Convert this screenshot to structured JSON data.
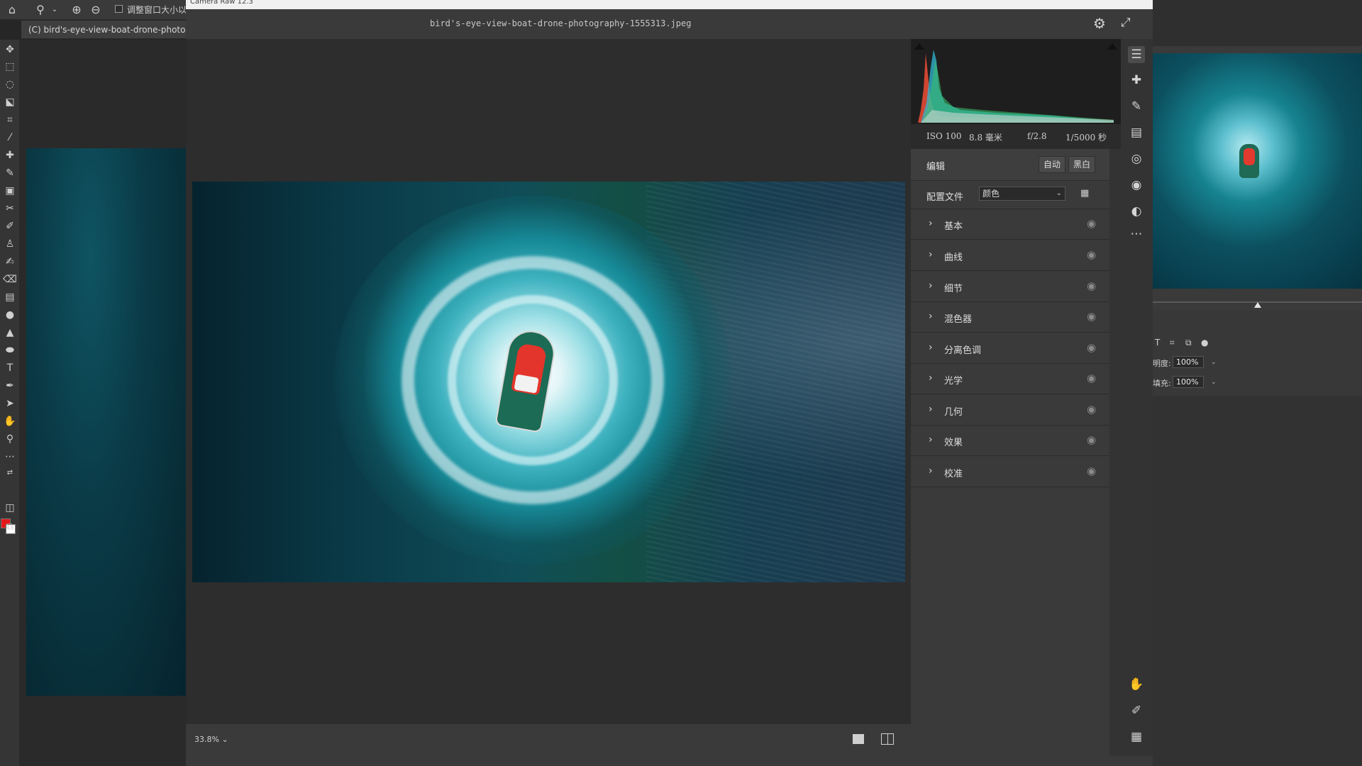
{
  "photoshop": {
    "options_bar": {
      "resize_windows_label": "调整窗口大小以"
    },
    "document_tab": {
      "title": "(C) bird's-eye-view-boat-drone-photograph"
    },
    "properties": {
      "opacity_label": "明度:",
      "opacity_value": "100%",
      "fill_label": "填充:",
      "fill_value": "100%"
    },
    "colors": {
      "foreground": "#e3181b",
      "background": "#ffffff"
    }
  },
  "camera_raw": {
    "window_title": "Camera Raw 12.3",
    "filename": "bird's-eye-view-boat-drone-photography-1555313.jpeg",
    "exif": {
      "iso": "ISO 100",
      "focal_length": "8.8 毫米",
      "aperture": "f/2.8",
      "shutter": "1/5000 秒"
    },
    "edit": {
      "title": "编辑",
      "auto_label": "自动",
      "bw_label": "黑白",
      "profile_label": "配置文件",
      "profile_value": "颜色"
    },
    "sections": [
      {
        "label": "基本"
      },
      {
        "label": "曲线"
      },
      {
        "label": "细节"
      },
      {
        "label": "混色器"
      },
      {
        "label": "分离色调"
      },
      {
        "label": "光学"
      },
      {
        "label": "几何"
      },
      {
        "label": "效果"
      },
      {
        "label": "校准"
      }
    ],
    "zoom": {
      "value": "33.8%"
    }
  }
}
